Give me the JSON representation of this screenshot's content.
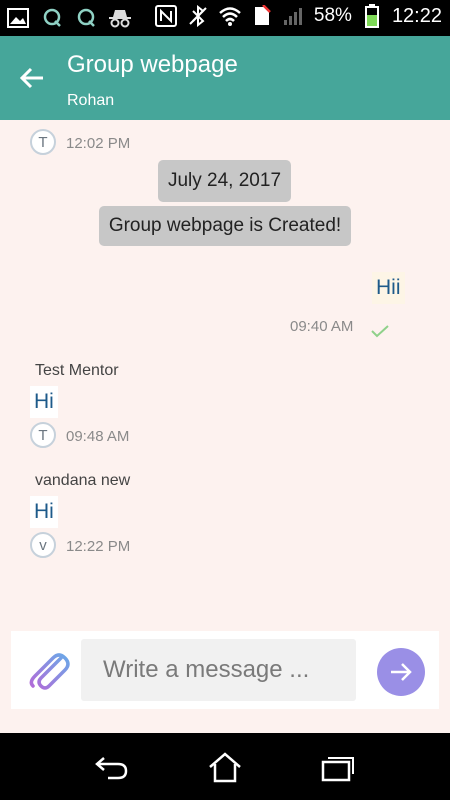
{
  "status_bar": {
    "battery_percent": "58%",
    "time": "12:22",
    "icons": [
      "gallery-icon",
      "app-icon",
      "app-icon",
      "incognito-icon",
      "nfc-icon",
      "bluetooth-icon",
      "wifi-icon",
      "sim-icon",
      "signal-icon",
      "battery-icon"
    ]
  },
  "toolbar": {
    "title": "Group webpage",
    "subtitle": "Rohan"
  },
  "chat": {
    "top_message": {
      "avatar": "T",
      "time": "12:02 PM"
    },
    "date_pill": "July 24, 2017",
    "system_pill": "Group webpage is Created!",
    "outgoing": {
      "text": "Hii",
      "time": "09:40 AM",
      "status_icon": "checkmark-icon"
    },
    "messages": [
      {
        "sender": "Test Mentor",
        "text": "Hi",
        "avatar": "T",
        "time": "09:48 AM"
      },
      {
        "sender": "vandana new",
        "text": "Hi",
        "avatar": "v",
        "time": "12:22 PM"
      }
    ]
  },
  "composer": {
    "placeholder": "Write a message ...",
    "value": "",
    "accent_color": "#9a8fe6"
  },
  "colors": {
    "toolbar": "#46a69a",
    "chat_background": "#fdf2ef",
    "message_text": "#1d5a8a"
  }
}
